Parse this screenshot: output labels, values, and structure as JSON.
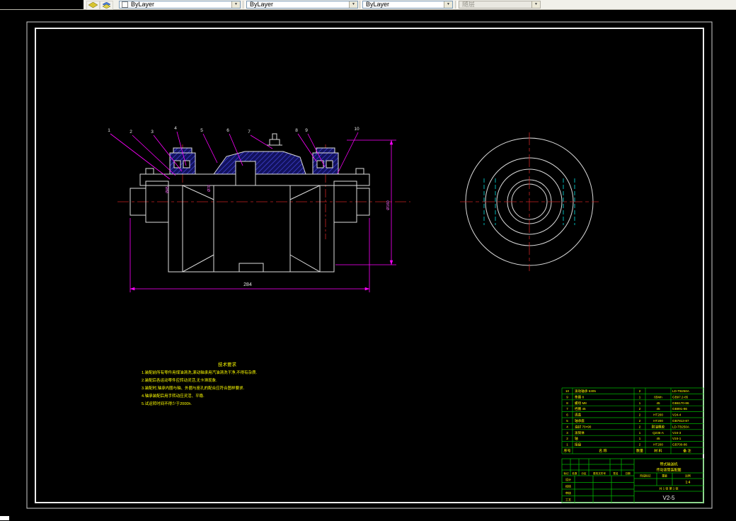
{
  "toolbar": {
    "color_value": "ByLayer",
    "linetype_value": "ByLayer",
    "lineweight_value": "ByLayer",
    "plot_style_value": "随层",
    "dropdown_glyph": "▼"
  },
  "drawing": {
    "callouts": [
      "1",
      "2",
      "3",
      "4",
      "5",
      "6",
      "7",
      "8",
      "9",
      "10"
    ],
    "dim_overall": "284",
    "dim_right": "Ø160",
    "dim_left_a": "Ø45",
    "dim_left_b": "Ø70"
  },
  "notes": {
    "title": "技术要求",
    "items": [
      "1.装配前所有零件用煤油清洗,滚动轴承用汽油清洗干净,不得有杂质.",
      "2.装配后各运动零件应转动灵活,无卡滞现象.",
      "3.装配时,轴承内圈与轴、外圈与座孔的配合应符合图样要求.",
      "4.轴承装配后用手转动应灵活、平稳.",
      "5.试运转时间不得少于2000h."
    ]
  },
  "parts_list": {
    "header": [
      "序号",
      "名 称",
      "数量",
      "材 料",
      "备 注"
    ],
    "rows": [
      [
        "10",
        "滚动轴承 5305",
        "2",
        "",
        "LD-TB250A"
      ],
      [
        "9",
        "垫圈 8",
        "1",
        "65Mn",
        "GB97.2-85"
      ],
      [
        "8",
        "螺母 M8",
        "1",
        "45",
        "GB6170-86"
      ],
      [
        "7",
        "挡圈 45",
        "2",
        "45",
        "GB891-86"
      ],
      [
        "6",
        "透盖",
        "2",
        "HT200",
        "V24-4"
      ],
      [
        "5",
        "轴承座",
        "2",
        "HT200",
        "GB7813-87"
      ],
      [
        "4",
        "油封 70×90",
        "2",
        "耐油橡胶",
        "LD-TB250A"
      ],
      [
        "3",
        "滚筒体",
        "1",
        "Q235-A",
        "V24-3"
      ],
      [
        "2",
        "轴",
        "1",
        "45",
        "V24-1"
      ],
      [
        "1",
        "接盘",
        "2",
        "HT200",
        "GB700-86"
      ]
    ]
  },
  "title_block": {
    "project_line1": "带式输送机",
    "project_line2": "传动滚筒装配图",
    "drawing_no": "V2-5",
    "stage_label": "阶段标记",
    "weight_label": "重量",
    "scale_label": "比例",
    "scale_value": "1:4",
    "sheet_text": "共 1 张 第 1 张",
    "change_labels": [
      "标记",
      "处数",
      "分区",
      "更改文件号",
      "签名",
      "日期"
    ],
    "sig_labels": [
      "设计",
      "校核",
      "审核",
      "工艺"
    ]
  }
}
